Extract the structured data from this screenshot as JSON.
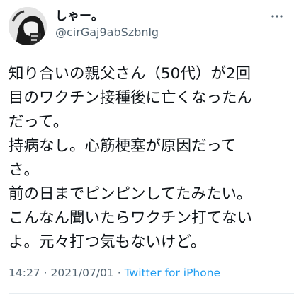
{
  "tweet": {
    "avatar_icon": "avatar-illustration",
    "display_name": "しゃー。",
    "username": "@cirGaj9abSzbnlg",
    "more_icon": "more-options-icon",
    "body_lines": [
      "知り合いの親父さん（50代）が2回",
      "目のワクチン接種後に亡くなったん",
      "だって。",
      "持病なし。心筋梗塞が原因だって",
      "さ。",
      "前の日までピンピンしてたみたい。",
      "こんなん聞いたらワクチン打てない",
      "よ。元々打つ気もないけど。"
    ],
    "time": "14:27",
    "separator": "·",
    "date": "2021/07/01",
    "source": "Twitter for iPhone",
    "colors": {
      "text": "#0f1419",
      "secondary": "#536471",
      "link": "#1d9bf0"
    }
  }
}
